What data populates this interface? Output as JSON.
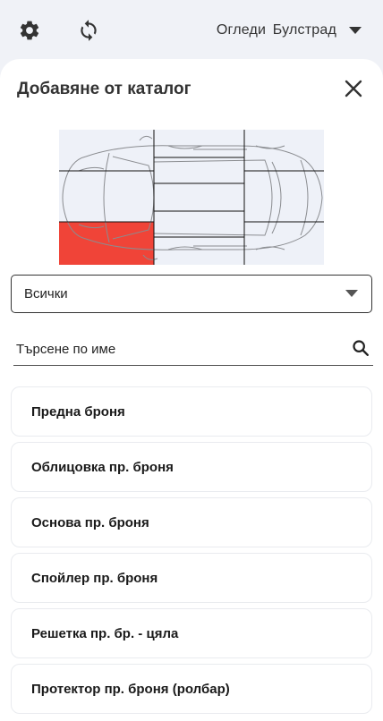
{
  "topbar": {
    "settings_icon": "gear-icon",
    "sync_icon": "sync-icon",
    "account_name": "Огледи Булстрад",
    "account_menu_icon": "caret-down-icon"
  },
  "sheet": {
    "title": "Добавяне от каталог",
    "close_icon": "close-icon"
  },
  "diagram": {
    "selected_zone": "front-left",
    "selected_color": "#f04438"
  },
  "filter": {
    "selected": "Всички"
  },
  "search": {
    "placeholder": "Търсене по име",
    "value": ""
  },
  "items": [
    {
      "label": "Предна броня"
    },
    {
      "label": "Облицовка пр. броня"
    },
    {
      "label": "Основа пр. броня"
    },
    {
      "label": "Спойлер пр. броня"
    },
    {
      "label": "Решетка пр. бр. - цяла"
    },
    {
      "label": "Протектор пр. броня (ролбар)"
    }
  ]
}
